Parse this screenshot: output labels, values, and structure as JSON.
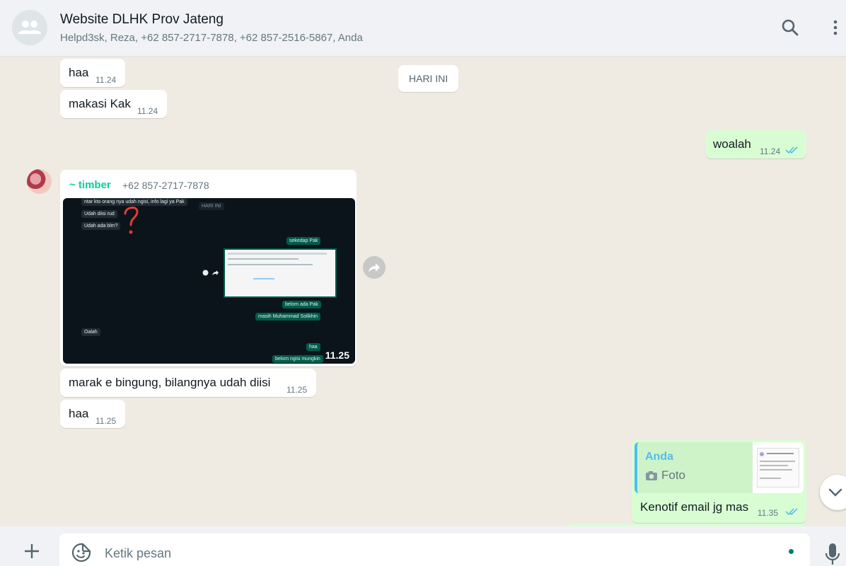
{
  "header": {
    "title": "Website DLHK Prov Jateng",
    "participants": "Helpd3sk, Reza, +62 857-2717-7878, +62 857-2516-5867, Anda"
  },
  "chat": {
    "date_chip": "HARI INI",
    "messages": [
      {
        "direction": "in",
        "text": "haa",
        "time": "11.24"
      },
      {
        "direction": "in",
        "text": "makasi Kak",
        "time": "11.24"
      },
      {
        "direction": "out",
        "text": "woalah",
        "time": "11.24",
        "status": "read"
      },
      {
        "direction": "in",
        "sender": "~ timber",
        "sender_phone": "+62 857-2717-7878",
        "type": "image",
        "time": "11.25"
      },
      {
        "direction": "in",
        "text": "marak e bingung, bilangnya udah diisi",
        "time": "11.25"
      },
      {
        "direction": "in",
        "text": "haa",
        "time": "11.25"
      },
      {
        "direction": "out",
        "reply_to": {
          "author": "Anda",
          "label": "Foto"
        },
        "text": "Kenotif email jg mas",
        "time": "11.35",
        "status": "read"
      }
    ],
    "image_contents": {
      "lines": [
        "ntar kto orang nya udah ngisi, info lagi ya Pak",
        "Udah diisi rud",
        "Udah ada blm?",
        "HARI INI",
        "sekedap Pak",
        "belom ada Pak",
        "masih Muhammad Solikhin",
        "Oalah",
        "haa",
        "belom ngisi mungkin"
      ],
      "times": [
        "10.14",
        "10.14",
        "10.26",
        "11.23",
        "11.23",
        "11.25",
        "11.24",
        "11.25"
      ]
    }
  },
  "footer": {
    "placeholder": "Ketik pesan"
  },
  "colors": {
    "accent": "#06cf9c",
    "outgoing_bubble": "#d9fdd3",
    "read_ticks": "#53bdeb",
    "background": "#efeae2"
  },
  "icons": {
    "group_avatar": "group-icon",
    "search": "search-icon",
    "menu": "more-vertical-icon",
    "forward": "forward-icon",
    "scroll_down": "chevron-down-icon",
    "attach": "plus-icon",
    "sticker": "sticker-icon",
    "mic": "mic-icon",
    "camera": "camera-icon"
  }
}
